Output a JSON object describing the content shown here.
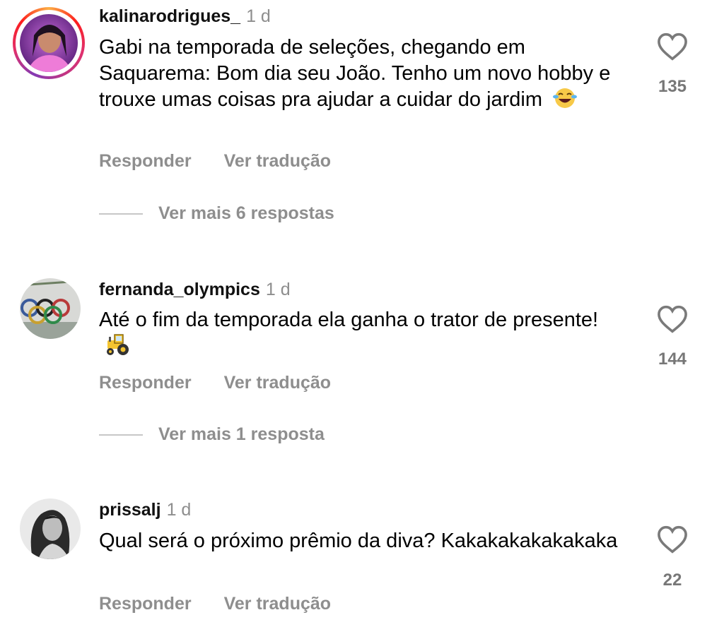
{
  "comments": [
    {
      "username": "kalinarodrigues_",
      "time": "1 d",
      "text": "Gabi na temporada de seleções, chegando em Saquarema: Bom dia seu João. Tenho um novo hobby e trouxe umas coisas pra ajudar a cuidar do jardim",
      "emoji": "😂",
      "reply_label": "Responder",
      "translate_label": "Ver tradução",
      "more_replies": "Ver mais 6 respostas",
      "likes": "135",
      "has_story_ring": true
    },
    {
      "username": "fernanda_olympics",
      "time": "1 d",
      "text": "Até o fim da temporada ela ganha o trator de presente!",
      "emoji": "🚜",
      "reply_label": "Responder",
      "translate_label": "Ver tradução",
      "more_replies": "Ver mais 1 resposta",
      "likes": "144",
      "has_story_ring": false
    },
    {
      "username": "prissalj",
      "time": "1 d",
      "text": "Qual será o próximo prêmio da diva? Kakakakakakakaka",
      "emoji": "",
      "reply_label": "Responder",
      "translate_label": "Ver tradução",
      "more_replies": "",
      "likes": "22",
      "has_story_ring": false
    }
  ],
  "icons": {
    "like": "heart-outline-icon"
  },
  "colors": {
    "muted_text": "#8e8e8e",
    "username": "#111111",
    "story_ring_start": "#fcaf45",
    "story_ring_mid": "#e1306c",
    "story_ring_end": "#833ab4"
  }
}
